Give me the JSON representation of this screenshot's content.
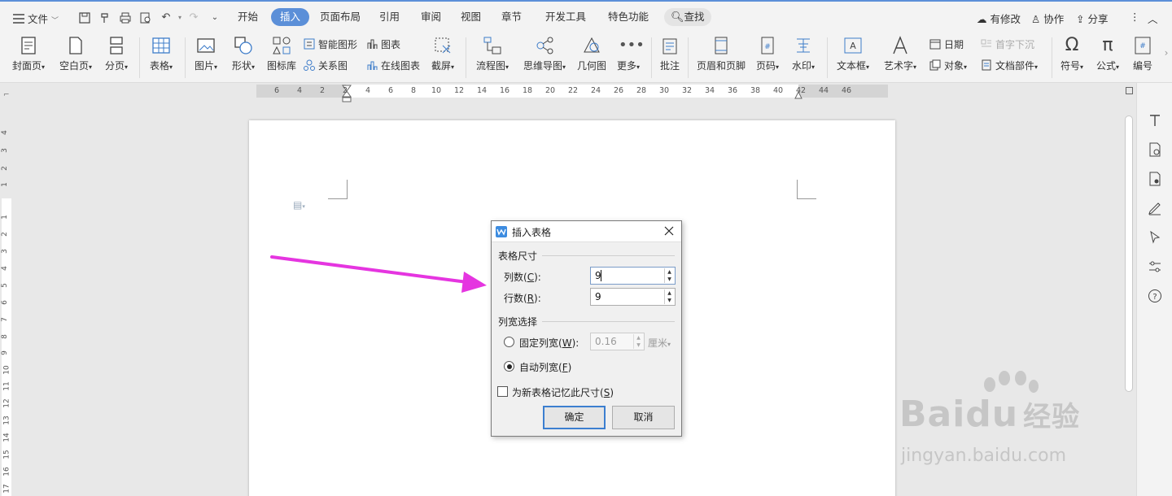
{
  "menubar": {
    "file": "文件",
    "tabs": [
      "开始",
      "插入",
      "页面布局",
      "引用",
      "审阅",
      "视图",
      "章节",
      "开发工具",
      "特色功能"
    ],
    "active_tab": "插入",
    "search": "查找",
    "right": {
      "changes": "有修改",
      "collab": "协作",
      "share": "分享"
    }
  },
  "ribbon": {
    "cover": "封面页",
    "blank": "空白页",
    "pagebreak": "分页",
    "table": "表格",
    "picture": "图片",
    "shape": "形状",
    "iconlib": "图标库",
    "smartart": "智能图形",
    "chart": "图表",
    "relation": "关系图",
    "onlinechart": "在线图表",
    "screenshot": "截屏",
    "flowchart": "流程图",
    "mindmap": "思维导图",
    "geometry": "几何图",
    "more": "更多",
    "comment": "批注",
    "headerfooter": "页眉和页脚",
    "pagenum": "页码",
    "watermark": "水印",
    "textbox": "文本框",
    "wordart": "艺术字",
    "date": "日期",
    "dropcap": "首字下沉",
    "object": "对象",
    "docparts": "文档部件",
    "symbol": "符号",
    "formula": "公式",
    "numbering": "编号"
  },
  "hruler": [
    "6",
    "4",
    "2",
    "2",
    "4",
    "6",
    "8",
    "10",
    "12",
    "14",
    "16",
    "18",
    "20",
    "22",
    "24",
    "26",
    "28",
    "30",
    "32",
    "34",
    "36",
    "38",
    "40",
    "42",
    "44",
    "46"
  ],
  "vruler": [
    "4",
    "3",
    "2",
    "1",
    "1",
    "2",
    "3",
    "4",
    "5",
    "6",
    "7",
    "8",
    "9",
    "10",
    "11",
    "12",
    "13",
    "14",
    "15",
    "16",
    "17"
  ],
  "dialog": {
    "title": "插入表格",
    "size_group": "表格尺寸",
    "cols_label": "列数(",
    "cols_key": "C",
    "cols_value": "9",
    "rows_label": "行数(",
    "rows_key": "R",
    "rows_value": "9",
    "width_group": "列宽选择",
    "fixed_label": "固定列宽(",
    "fixed_key": "W",
    "fixed_value": "0.16",
    "fixed_unit": "厘米",
    "auto_label": "自动列宽(",
    "auto_key": "F",
    "remember_label": "为新表格记忆此尺寸(",
    "remember_key": "S",
    "ok": "确定",
    "cancel": "取消",
    "selected_width_mode": "auto",
    "remember_checked": false
  },
  "watermark": {
    "brand": "Baidu",
    "cn": "经验",
    "url": "jingyan.baidu.com"
  },
  "colors": {
    "accent": "#5b8fd8",
    "arrow": "#e535e0"
  }
}
